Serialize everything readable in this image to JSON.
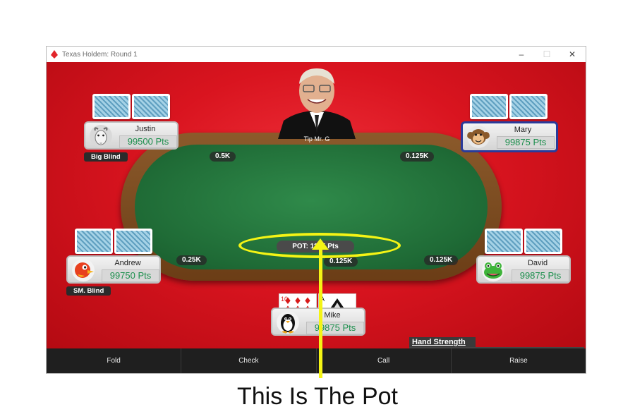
{
  "window": {
    "title": "Texas Holdem: Round 1",
    "controls": [
      "–",
      "☐",
      "✕"
    ]
  },
  "dealer": {
    "label": "Tip Mr. G"
  },
  "bets": {
    "justin": "0.5K",
    "mary": "0.125K",
    "andrew": "0.25K",
    "center": "0.125K",
    "david": "0.125K"
  },
  "pot": {
    "label": "POT: 1125 Pts"
  },
  "players": {
    "justin": {
      "name": "Justin",
      "points": "99500 Pts",
      "tag": "Big Blind",
      "avatar": "goat-icon"
    },
    "mary": {
      "name": "Mary",
      "points": "99875 Pts",
      "avatar": "monkey-icon"
    },
    "andrew": {
      "name": "Andrew",
      "points": "99750 Pts",
      "tag": "SM. Blind",
      "avatar": "bird-icon"
    },
    "david": {
      "name": "David",
      "points": "99875 Pts",
      "avatar": "frog-icon"
    },
    "mike": {
      "name": "Mike",
      "points": "99875 Pts",
      "avatar": "penguin-icon"
    }
  },
  "my_cards": [
    {
      "rank": "10",
      "suit": "♦",
      "color": "#d81a1a"
    },
    {
      "rank": "A",
      "suit": "♠",
      "color": "#111111"
    }
  ],
  "hand_strength": {
    "label": "Hand Strength",
    "fraction": 0.38,
    "color": "#f5f500"
  },
  "actions": [
    "Fold",
    "Check",
    "Call",
    "Raise"
  ],
  "annotation": {
    "caption": "This Is The Pot",
    "color": "#f4f415"
  }
}
